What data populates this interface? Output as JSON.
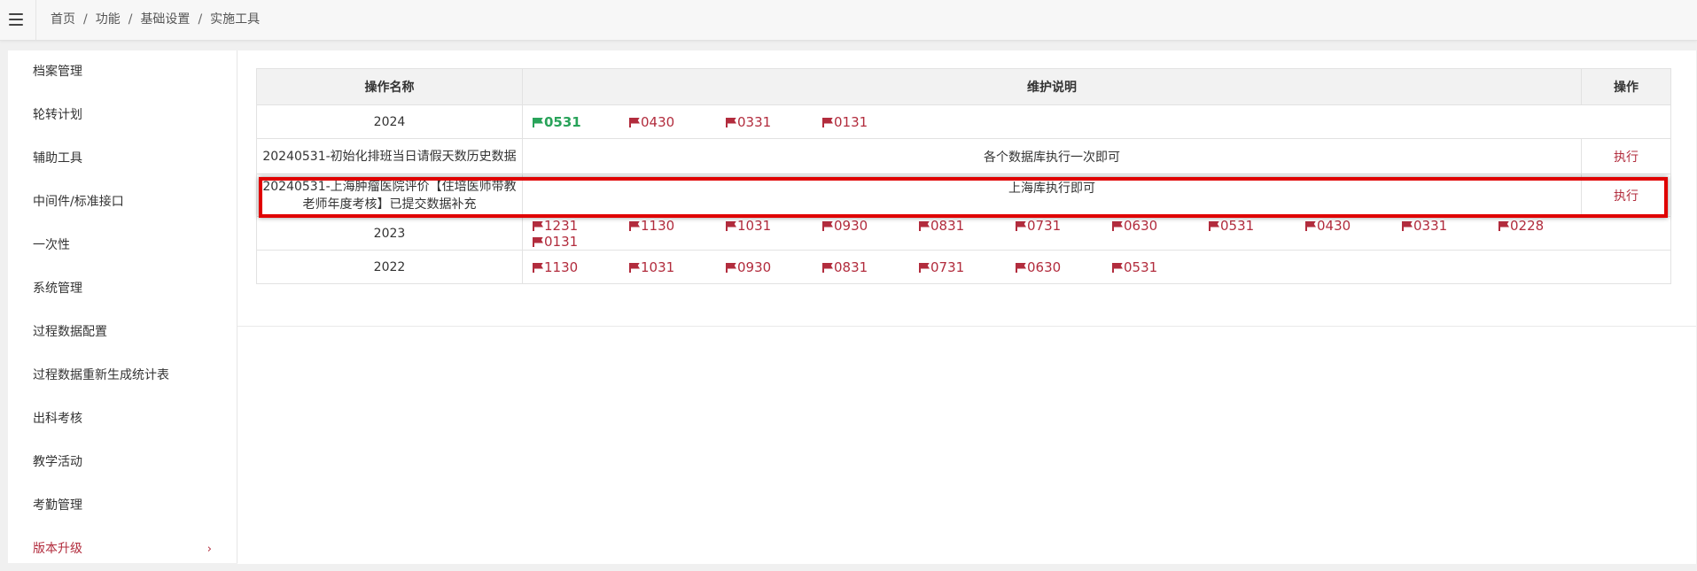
{
  "breadcrumb": [
    "首页",
    "功能",
    "基础设置",
    "实施工具"
  ],
  "sidebar": {
    "items": [
      {
        "label": "档案管理"
      },
      {
        "label": "轮转计划"
      },
      {
        "label": "辅助工具"
      },
      {
        "label": "中间件/标准接口"
      },
      {
        "label": "一次性"
      },
      {
        "label": "系统管理"
      },
      {
        "label": "过程数据配置"
      },
      {
        "label": "过程数据重新生成统计表"
      },
      {
        "label": "出科考核"
      },
      {
        "label": "教学活动"
      },
      {
        "label": "考勤管理"
      },
      {
        "label": "版本升级",
        "expand": "›"
      }
    ]
  },
  "table": {
    "headers": [
      "操作名称",
      "维护说明",
      "操作"
    ],
    "rows": [
      {
        "name": "2024",
        "versions": [
          "0531",
          "0430",
          "0331",
          "0131"
        ],
        "active_version": "0531"
      },
      {
        "name": "20240531-初始化排班当日请假天数历史数据",
        "desc": "各个数据库执行一次即可",
        "action": "执行"
      },
      {
        "name": "20240531-上海肿瘤医院评价【住培医师带教老师年度考核】已提交数据补充",
        "desc": "上海库执行即可",
        "action": "执行"
      },
      {
        "name": "2023",
        "versions": [
          "1231",
          "1130",
          "1031",
          "0930",
          "0831",
          "0731",
          "0630",
          "0531",
          "0430",
          "0331",
          "0228",
          "0131"
        ]
      },
      {
        "name": "2022",
        "versions": [
          "1130",
          "1031",
          "0930",
          "0831",
          "0731",
          "0630",
          "0531"
        ]
      }
    ]
  },
  "colors": {
    "accent": "#b22c3d",
    "active": "#29a35a",
    "highlight": "#e00000"
  },
  "icons": {
    "menu": "hamburger-icon",
    "version_flag": "flag-icon",
    "expand": "chevron-right-icon"
  }
}
